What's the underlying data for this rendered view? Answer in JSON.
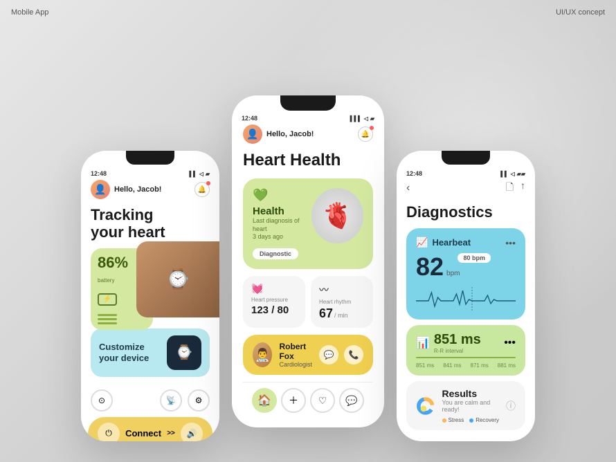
{
  "page": {
    "label_left": "Mobile App",
    "label_right": "UI/UX concept"
  },
  "phone1": {
    "status_time": "12:48",
    "greeting": "Hello, Jacob!",
    "hero_title": "Tracking\nyour heart",
    "battery_percent": "86%",
    "battery_label": "battery",
    "customize_title": "Customize\nyour device",
    "connect_label": "Connect",
    "connect_arrows": ">>"
  },
  "phone2": {
    "status_time": "12:48",
    "greeting": "Hello, Jacob!",
    "page_title": "Heart Health",
    "health_label": "Health",
    "health_sub": "Last diagnosis of heart\n3 days ago",
    "diag_btn": "Diagnostic",
    "heart_pressure_label": "Heart pressure",
    "heart_pressure_value": "123 / 80",
    "heart_rhythm_label": "Heart rhythm",
    "heart_rhythm_value": "67",
    "heart_rhythm_unit": "/ min",
    "doctor_name": "Robert Fox",
    "doctor_title": "Cardiologist"
  },
  "phone3": {
    "status_time": "12:48",
    "page_title": "Diagnostics",
    "heartbeat_title": "Hearbeat",
    "heartbeat_bpm": "82",
    "heartbeat_unit": "bpm",
    "bpm_badge": "80 bpm",
    "rr_title": "R-R interval",
    "rr_value": "851 ms",
    "rr_markers": [
      "851 ms",
      "841 ms",
      "871 ms",
      "881 ms"
    ],
    "results_title": "Results",
    "results_sub": "You are calm and ready!",
    "stress_label": "Stress",
    "recovery_label": "Recovery",
    "stress_color": "#ffb74d",
    "recovery_color": "#42a5f5"
  }
}
